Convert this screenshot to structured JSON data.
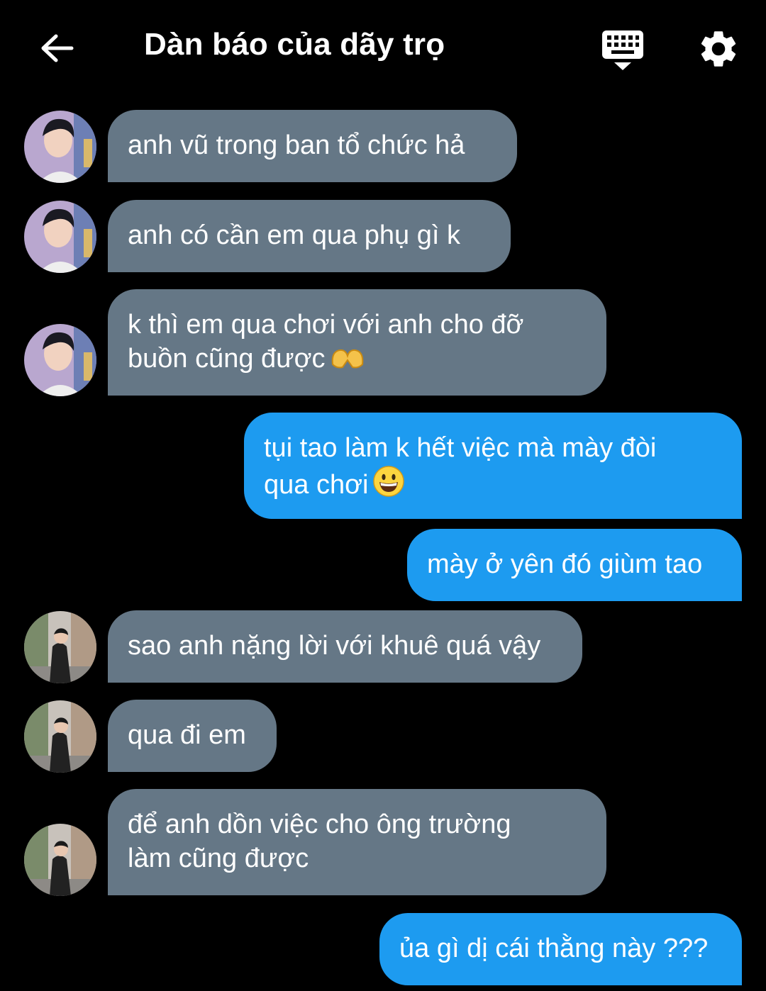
{
  "header": {
    "title": "Dàn báo của dãy trọ",
    "back_icon": "arrow-left-icon",
    "keyboard_icon": "keyboard-icon",
    "settings_icon": "gear-icon"
  },
  "colors": {
    "background": "#000000",
    "incoming_bubble": "#657786",
    "outgoing_bubble": "#1d9bf0",
    "text": "#ffffff"
  },
  "messages": [
    {
      "direction": "incoming",
      "sender": "user-1",
      "lines": [
        "anh vũ trong ban tổ chức hả"
      ]
    },
    {
      "direction": "incoming",
      "sender": "user-1",
      "lines": [
        "anh có cần em qua phụ gì k"
      ]
    },
    {
      "direction": "incoming",
      "sender": "user-1",
      "lines": [
        "k thì em qua chơi với anh cho đỡ",
        "buồn cũng được"
      ],
      "emoji": "heart-hands-emoji"
    },
    {
      "direction": "outgoing",
      "lines": [
        "tụi tao làm k hết việc mà mày đòi",
        "qua chơi"
      ],
      "emoji": "grinning-face-emoji"
    },
    {
      "direction": "outgoing",
      "lines": [
        "mày ở yên đó giùm tao"
      ]
    },
    {
      "direction": "incoming",
      "sender": "user-2",
      "lines": [
        "sao anh nặng lời với khuê quá vậy"
      ]
    },
    {
      "direction": "incoming",
      "sender": "user-2",
      "lines": [
        "qua đi em"
      ]
    },
    {
      "direction": "incoming",
      "sender": "user-2",
      "lines": [
        "để anh dồn việc cho ông trường",
        "làm cũng được"
      ]
    },
    {
      "direction": "outgoing",
      "lines": [
        "ủa gì dị cái thằng này ???"
      ]
    }
  ]
}
